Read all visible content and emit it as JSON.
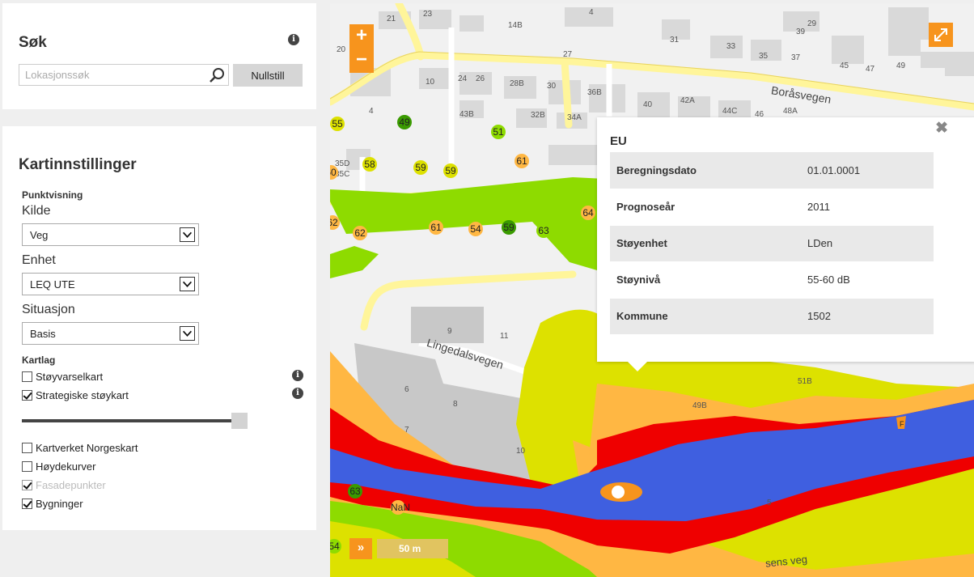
{
  "search": {
    "title": "Søk",
    "placeholder": "Lokasjonssøk",
    "reset_label": "Nullstill"
  },
  "settings": {
    "title": "Kartinnstillinger",
    "point_display_label": "Punktvisning",
    "source_label": "Kilde",
    "source_value": "Veg",
    "unit_label": "Enhet",
    "unit_value": "LEQ UTE",
    "situation_label": "Situasjon",
    "situation_value": "Basis",
    "layers_label": "Kartlag",
    "layers": [
      {
        "label": "Støyvarselkart",
        "checked": false,
        "disabled": false
      },
      {
        "label": "Strategiske støykart",
        "checked": true,
        "disabled": false
      },
      {
        "label": "Kartverket Norgeskart",
        "checked": false,
        "disabled": false
      },
      {
        "label": "Høydekurver",
        "checked": false,
        "disabled": false
      },
      {
        "label": "Fasadepunkter",
        "checked": true,
        "disabled": true
      },
      {
        "label": "Bygninger",
        "checked": true,
        "disabled": false
      }
    ],
    "opacity_level": 1.0
  },
  "map": {
    "zoom_in": "+",
    "zoom_out": "−",
    "scale_label": "50 m",
    "street_labels": [
      "Boråsvegen",
      "Lingedalsvegen",
      "sens veg"
    ],
    "building_numbers": [
      "21",
      "23",
      "4",
      "14B",
      "39",
      "29",
      "31",
      "33",
      "35",
      "37",
      "45",
      "47",
      "49",
      "20",
      "27",
      "10",
      "24",
      "26",
      "28B",
      "30",
      "36B",
      "40",
      "42A",
      "44C",
      "46",
      "48A",
      "4",
      "43B",
      "32B",
      "34A",
      "35D",
      "35C",
      "9",
      "11",
      "6",
      "8",
      "7",
      "10",
      "51B",
      "49B",
      "5"
    ],
    "noise_markers": [
      "55",
      "49",
      "51",
      "61",
      "58",
      "59",
      "59",
      "60",
      "61",
      "62",
      "62",
      "61",
      "54",
      "59",
      "63",
      "64",
      "NaN",
      "63",
      "54",
      "62"
    ],
    "colors": {
      "band_yellow": "#dde100",
      "band_green": "#8edb00",
      "band_orange": "#ffb743",
      "band_red": "#ef0000",
      "water_blue": "#3f5fe0",
      "road": "#fff59a",
      "accent": "#f7941d"
    }
  },
  "popup": {
    "title": "EU",
    "rows": [
      {
        "key": "Beregningsdato",
        "value": "01.01.0001"
      },
      {
        "key": "Prognoseår",
        "value": "2011"
      },
      {
        "key": "Støyenhet",
        "value": "LDen"
      },
      {
        "key": "Støynivå",
        "value": "55-60 dB"
      },
      {
        "key": "Kommune",
        "value": "1502"
      }
    ]
  }
}
